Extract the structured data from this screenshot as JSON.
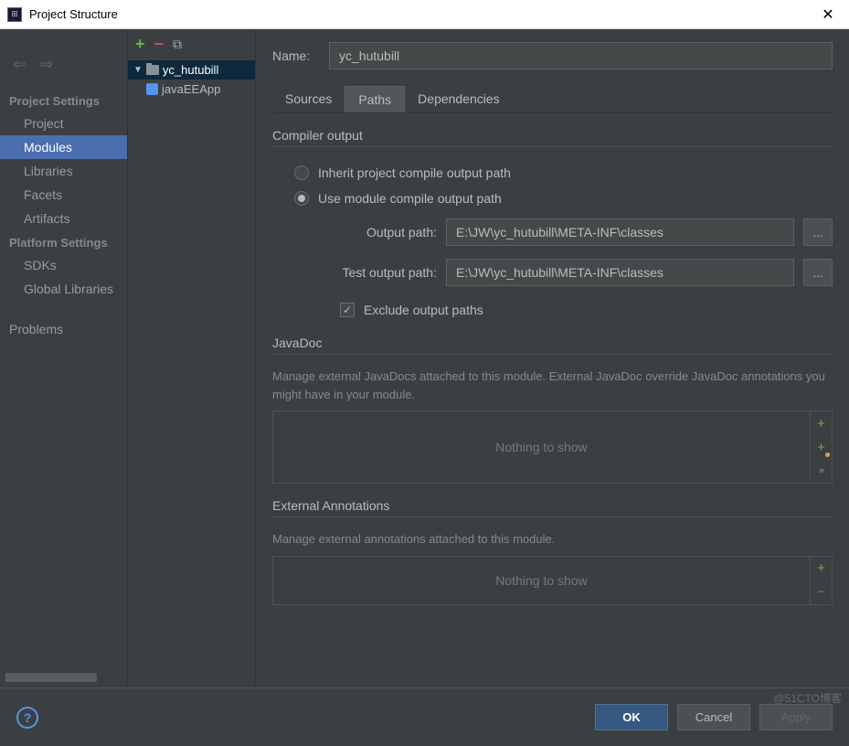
{
  "titlebar": {
    "title": "Project Structure"
  },
  "nav": {
    "section1": "Project Settings",
    "items1": [
      "Project",
      "Modules",
      "Libraries",
      "Facets",
      "Artifacts"
    ],
    "section2": "Platform Settings",
    "items2": [
      "SDKs",
      "Global Libraries"
    ],
    "section3_item": "Problems"
  },
  "tree": {
    "root": "yc_hutubill",
    "child": "javaEEApp"
  },
  "form": {
    "name_label": "Name:",
    "name_value": "yc_hutubill",
    "tabs": [
      "Sources",
      "Paths",
      "Dependencies"
    ]
  },
  "compiler": {
    "title": "Compiler output",
    "radio1": "Inherit project compile output path",
    "radio2": "Use module compile output path",
    "output_label": "Output path:",
    "output_value": "E:\\JW\\yc_hutubill\\META-INF\\classes",
    "test_label": "Test output path:",
    "test_value": "E:\\JW\\yc_hutubill\\META-INF\\classes",
    "exclude_label": "Exclude output paths"
  },
  "javadoc": {
    "title": "JavaDoc",
    "desc": "Manage external JavaDocs attached to this module. External JavaDoc override JavaDoc annotations you might have in your module.",
    "empty": "Nothing to show"
  },
  "annotations": {
    "title": "External Annotations",
    "desc": "Manage external annotations attached to this module.",
    "empty": "Nothing to show"
  },
  "footer": {
    "ok": "OK",
    "cancel": "Cancel",
    "apply": "Apply"
  },
  "watermark": "@51CTO博客",
  "browse": "..."
}
